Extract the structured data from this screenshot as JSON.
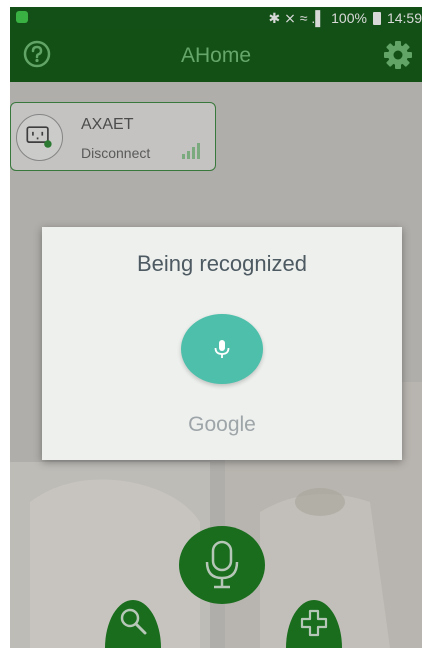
{
  "status_bar": {
    "signal_text": "✱ ⨯ ≈ .▌",
    "battery_percent": "100%",
    "time": "14:59",
    "icons": [
      "app-notification-icon",
      "bluetooth-icon",
      "mute-icon",
      "wifi-icon",
      "cell-signal-icon",
      "battery-icon"
    ]
  },
  "app_bar": {
    "title": "AHome",
    "left_icon": "help-icon",
    "right_icon": "gear-icon",
    "background": "#0e5a12",
    "title_color": "#75c37a"
  },
  "devices": [
    {
      "name": "AXAET",
      "status": "Disconnect",
      "icon": "socket-plug-icon",
      "signal_icon": "signal-bars-icon"
    }
  ],
  "voice_dialog": {
    "title": "Being recognized",
    "brand": "Google",
    "mic_color": "#4dbfaa"
  },
  "bottom_buttons": {
    "voice": "microphone-icon",
    "search": "search-icon",
    "add": "add-icon",
    "color": "#167d1c"
  }
}
